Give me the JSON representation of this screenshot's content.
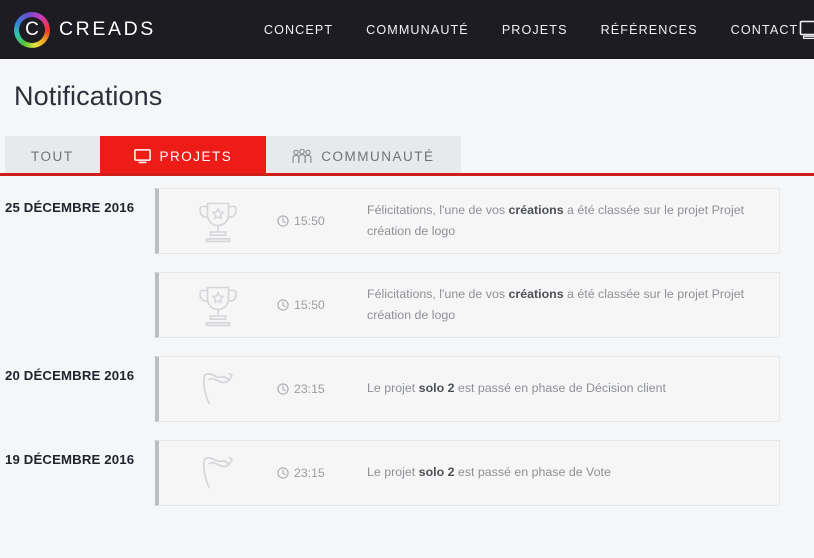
{
  "header": {
    "brand": {
      "mark": "C",
      "name": "CREADS"
    },
    "nav": [
      {
        "label": "CONCEPT",
        "name": "nav-concept"
      },
      {
        "label": "COMMUNAUTÉ",
        "name": "nav-communaute"
      },
      {
        "label": "PROJETS",
        "name": "nav-projets"
      },
      {
        "label": "RÉFÉRENCES",
        "name": "nav-references"
      },
      {
        "label": "CONTACT",
        "name": "nav-contact"
      }
    ],
    "right_icon": "monitor-icon",
    "bg_color": "#1c1c22"
  },
  "page": {
    "title": "Notifications",
    "bg_color": "#f5f6f8"
  },
  "tabs": {
    "accent_color": "#ed1c16",
    "rule_color": "#cf1f18",
    "items": [
      {
        "label": "TOUT",
        "icon": null,
        "active": false
      },
      {
        "label": "PROJETS",
        "icon": "monitor-icon",
        "active": true
      },
      {
        "label": "COMMUNAUTÉ",
        "icon": "people-group-icon",
        "active": false
      }
    ]
  },
  "notifications": {
    "groups": [
      {
        "date": "25 DÉCEMBRE 2016",
        "cards": [
          {
            "icon": "trophy-icon",
            "time": "15:50",
            "text_before": "Félicitations, l'une de vos ",
            "text_strong": "créations",
            "text_after": " a été classée sur le projet Projet création de logo"
          },
          {
            "icon": "trophy-icon",
            "time": "15:50",
            "text_before": "Félicitations, l'une de vos ",
            "text_strong": "créations",
            "text_after": " a été classée sur le projet Projet création de logo"
          }
        ]
      },
      {
        "date": "20 DÉCEMBRE 2016",
        "cards": [
          {
            "icon": "flag-icon",
            "time": "23:15",
            "text_before": "Le projet ",
            "text_strong": "solo 2",
            "text_after": " est passé en phase de Décision client"
          }
        ]
      },
      {
        "date": "19 DÉCEMBRE 2016",
        "cards": [
          {
            "icon": "flag-icon",
            "time": "23:15",
            "text_before": "Le projet ",
            "text_strong": "solo 2",
            "text_after": " est passé en phase de Vote"
          }
        ]
      }
    ]
  }
}
